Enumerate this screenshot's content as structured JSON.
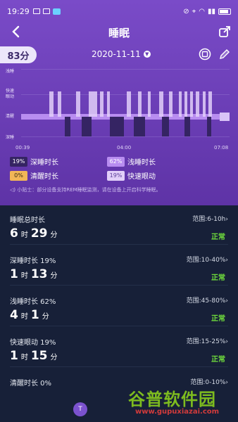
{
  "status_bar": {
    "time": "19:29",
    "right_text": "•"
  },
  "header": {
    "title": "睡眠"
  },
  "score": "83分",
  "date": "2020-11-11",
  "chart_data": {
    "type": "area",
    "y_levels": [
      "浅睡",
      "快速\n眼动",
      "清醒",
      "深睡"
    ],
    "x_ticks": [
      "00:39",
      "04:00",
      "07:08"
    ],
    "x_range": [
      "00:39",
      "07:08"
    ]
  },
  "legend": [
    {
      "pct": "19%",
      "label": "深睡时长",
      "color": "#352463",
      "text_color": "#ffffff"
    },
    {
      "pct": "62%",
      "label": "浅睡时长",
      "color": "#b88df0",
      "text_color": "#ffffff"
    },
    {
      "pct": "0%",
      "label": "清醒时长",
      "color": "#f2b657",
      "text_color": "#3a2a10"
    },
    {
      "pct": "19%",
      "label": "快速眼动",
      "color": "#e2cff9",
      "text_color": "#5a3c98"
    }
  ],
  "tip": "◁) 小贴士：部分设备支持REM睡眠监测，请在设备上开启科学睡眠。",
  "stats": [
    {
      "label": "睡眠总时长",
      "range": "范围:6-10h",
      "h": "6",
      "hu": "时",
      "m": "29",
      "mu": "分",
      "status": "正常"
    },
    {
      "label": "深睡时长 19%",
      "range": "范围:10-40%",
      "h": "1",
      "hu": "时",
      "m": "13",
      "mu": "分",
      "status": "正常"
    },
    {
      "label": "浅睡时长 62%",
      "range": "范围:45-80%",
      "h": "4",
      "hu": "时",
      "m": "1",
      "mu": "分",
      "status": "正常"
    },
    {
      "label": "快速眼动 19%",
      "range": "范围:15-25%",
      "h": "1",
      "hu": "时",
      "m": "15",
      "mu": "分",
      "status": "正常"
    },
    {
      "label": "清醒时长 0%",
      "range": "范围:0-10%"
    }
  ],
  "range_arrow": "›",
  "bottom_button": "T",
  "watermark": {
    "main": "谷普软件园",
    "url": "www.gupuxiazai.com"
  },
  "colors": {
    "accent": "#7a4bc8",
    "normal": "#6fdc3c",
    "stats_bg": "#172038"
  }
}
